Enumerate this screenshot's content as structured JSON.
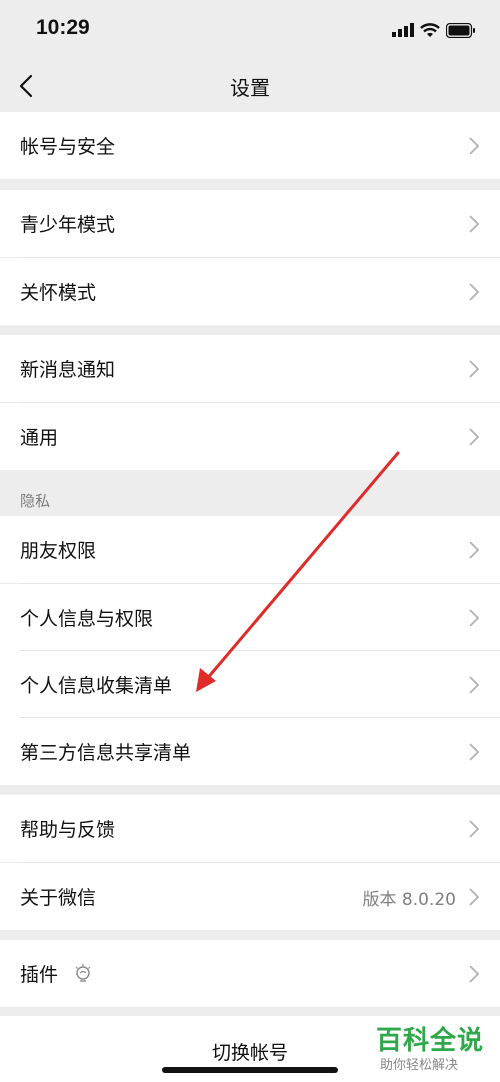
{
  "status_bar": {
    "time": "10:29"
  },
  "nav": {
    "title": "设置"
  },
  "rows": [
    {
      "label": "帐号与安全"
    },
    {
      "label": "青少年模式"
    },
    {
      "label": "关怀模式"
    },
    {
      "label": "新消息通知"
    },
    {
      "label": "通用"
    },
    {
      "label": "朋友权限"
    },
    {
      "label": "个人信息与权限"
    },
    {
      "label": "个人信息收集清单"
    },
    {
      "label": "第三方信息共享清单"
    },
    {
      "label": "帮助与反馈"
    },
    {
      "label": "关于微信",
      "value": "版本 8.0.20"
    },
    {
      "label": "插件"
    }
  ],
  "section": {
    "privacy": "隐私"
  },
  "bottom": {
    "switch_account": "切换帐号"
  },
  "watermark": {
    "title": "百科全说",
    "subtitle": "助你轻松解决"
  },
  "colors": {
    "background": "#ededed",
    "annotation_arrow": "#e02b2b",
    "watermark_green": "#2fa84a"
  }
}
